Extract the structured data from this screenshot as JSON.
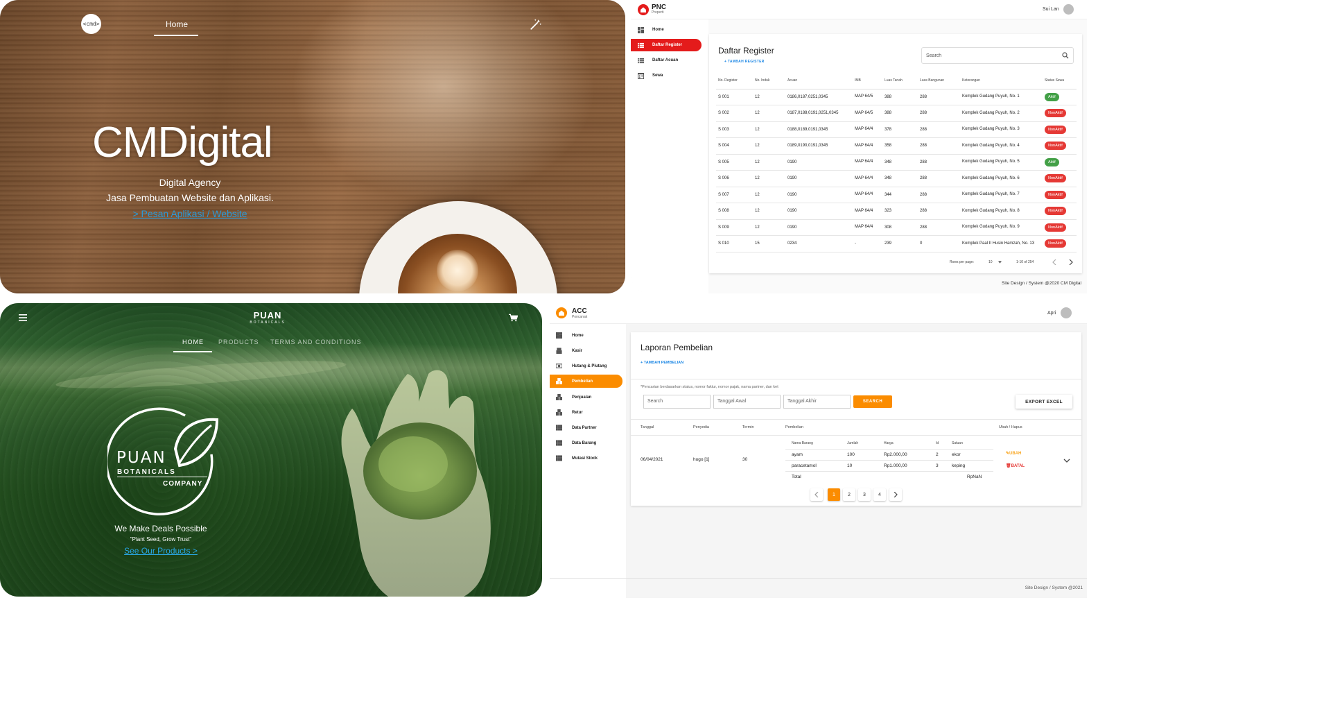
{
  "cmdigital": {
    "logo_text": "<cmd>",
    "nav_home": "Home",
    "title": "CMDigital",
    "subtitle_1": "Digital Agency",
    "subtitle_2": "Jasa Pembuatan Website dan Aplikasi.",
    "cta": "> Pesan Aplikasi / Website"
  },
  "pnc": {
    "brand": "PNC",
    "brand_sub": "Properti",
    "user": "Sui Lan",
    "accent": "#e41b1b",
    "sidebar": [
      {
        "label": "Home",
        "icon": "dashboard-icon"
      },
      {
        "label": "Daftar Register",
        "icon": "list-icon",
        "active": true
      },
      {
        "label": "Daftar Acuan",
        "icon": "list-icon"
      },
      {
        "label": "Sewa",
        "icon": "calendar-icon"
      }
    ],
    "page_title": "Daftar Register",
    "add_label": "+ TAMBAH REGISTER",
    "search_placeholder": "Search",
    "columns": [
      "No. Register",
      "No. Induk",
      "Acuan",
      "IMB",
      "Luas Tanah",
      "Luas Bangunan",
      "Keterangan",
      "Status Sewa"
    ],
    "rows": [
      [
        "S 001",
        "12",
        "0186,0187,0251,0345",
        "MAP 64/5",
        "388",
        "288",
        "Komplek Gudang Puyuh, No. 1",
        "Aktif"
      ],
      [
        "S 002",
        "12",
        "0187,0188,0191,0251,0345",
        "MAP 64/5",
        "388",
        "288",
        "Komplek Gudang Puyuh, No. 2",
        "NonAktif"
      ],
      [
        "S 003",
        "12",
        "0188,0189,0191,0345",
        "MAP 64/4",
        "378",
        "288",
        "Komplek Gudang Puyuh, No. 3",
        "NonAktif"
      ],
      [
        "S 004",
        "12",
        "0189,0190,0191,0345",
        "MAP 64/4",
        "358",
        "288",
        "Komplek Gudang Puyuh, No. 4",
        "NonAktif"
      ],
      [
        "S 005",
        "12",
        "0190",
        "MAP 64/4",
        "348",
        "288",
        "Komplek Gudang Puyuh, No. 5",
        "Aktif"
      ],
      [
        "S 006",
        "12",
        "0190",
        "MAP 64/4",
        "348",
        "288",
        "Komplek Gudang Puyuh, No. 6",
        "NonAktif"
      ],
      [
        "S 007",
        "12",
        "0190",
        "MAP 64/4",
        "344",
        "288",
        "Komplek Gudang Puyuh, No. 7",
        "NonAktif"
      ],
      [
        "S 008",
        "12",
        "0190",
        "MAP 64/4",
        "323",
        "288",
        "Komplek Gudang Puyuh, No. 8",
        "NonAktif"
      ],
      [
        "S 009",
        "12",
        "0190",
        "MAP 64/4",
        "308",
        "288",
        "Komplek Gudang Puyuh, No. 9",
        "NonAktif"
      ],
      [
        "S 010",
        "15",
        "0234",
        "-",
        "239",
        "0",
        "Komplek Paal II Husin Hamzah, No. 13",
        "NonAktif"
      ]
    ],
    "rows_per_page_label": "Rows per page:",
    "rows_per_page": "10",
    "range": "1-10 of 254",
    "footer": "Site Design / System @2020 CM Digital"
  },
  "puan": {
    "brand": "PUAN",
    "brand_sub": "BOTANICALS",
    "nav": [
      "HOME",
      "PRODUCTS",
      "TERMS AND CONDITIONS"
    ],
    "emblem_line1": "PUAN",
    "emblem_line2": "BOTANICALS",
    "emblem_line3": "COMPANY",
    "tagline": "We Make Deals Possible",
    "quote": "\"Plant Seed, Grow Trust\"",
    "cta": "See Our Products >"
  },
  "acc": {
    "brand": "ACC",
    "brand_sub": "Poncanak",
    "user": "Apri",
    "accent": "#fb8c00",
    "sidebar": [
      {
        "label": "Home",
        "icon": "dashboard-icon"
      },
      {
        "label": "Kasir",
        "icon": "cashier-icon"
      },
      {
        "label": "Hutang & Piutang",
        "icon": "money-icon"
      },
      {
        "label": "Pembelian",
        "icon": "boxes-icon",
        "active": true
      },
      {
        "label": "Penjualan",
        "icon": "boxes-icon"
      },
      {
        "label": "Retur",
        "icon": "boxes-icon"
      },
      {
        "label": "Data Partner",
        "icon": "list-icon"
      },
      {
        "label": "Data Barang",
        "icon": "list-icon"
      },
      {
        "label": "Mutasi Stock",
        "icon": "list-icon"
      }
    ],
    "page_title": "Laporan Pembelian",
    "add_label": "+ TAMBAH PEMBELIAN",
    "hint": "*Pencarian berdasarkan status, nomor faktur, nomor pajak, nama partner, dan ket",
    "search_placeholder": "Search",
    "date_start_placeholder": "Tanggal Awal",
    "date_end_placeholder": "Tanggal Akhir",
    "search_button": "SEARCH",
    "export_button": "EXPORT EXCEL",
    "columns": [
      "Tanggal",
      "Penyedia",
      "Termin",
      "Pembelian",
      "Ubah / Hapus"
    ],
    "row": {
      "tanggal": "06/04/2021",
      "penyedia": "hugo [1]",
      "termin": "30"
    },
    "inner_columns": [
      "Nama Barang",
      "Jumlah",
      "Harga",
      "Id",
      "Satuan"
    ],
    "inner_rows": [
      [
        "ayam",
        "100",
        "Rp2.000,00",
        "2",
        "ekor"
      ],
      [
        "paracetamol",
        "10",
        "Rp1.000,00",
        "3",
        "keping"
      ]
    ],
    "total_label": "Total",
    "total_value": "RpNaN",
    "ubah": "UBAH",
    "batal": "BATAL",
    "pages": [
      "1",
      "2",
      "3",
      "4"
    ],
    "current_page": "1",
    "footer": "Site Design / System @2021"
  }
}
